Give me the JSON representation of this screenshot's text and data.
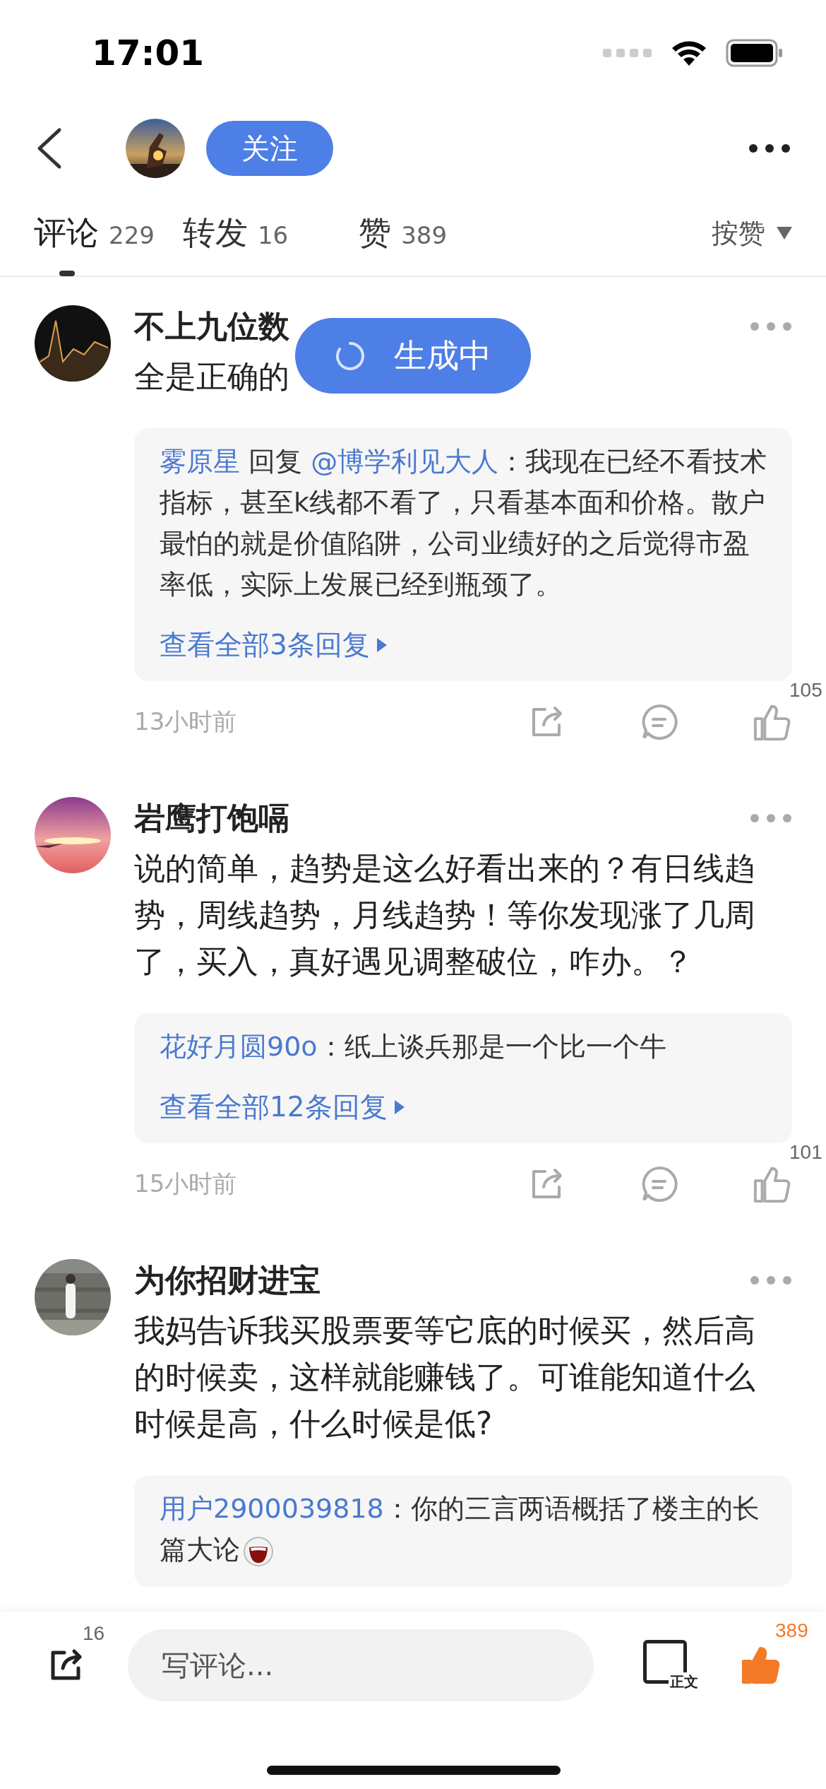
{
  "status_bar": {
    "time": "17:01"
  },
  "header": {
    "follow_button": "关注"
  },
  "tabs": [
    {
      "label": "评论",
      "count": "229",
      "selected": true
    },
    {
      "label": "转发",
      "count": "16",
      "selected": false
    },
    {
      "label": "赞",
      "count": "389",
      "selected": false
    }
  ],
  "sort": {
    "label": "按赞"
  },
  "toast": {
    "text": "生成中"
  },
  "comments": [
    {
      "author": "不上九位数",
      "content": "全是正确的",
      "reply": [
        {
          "kind": "user",
          "text": "雾原星"
        },
        {
          "kind": "plain",
          "text": " 回复 "
        },
        {
          "kind": "user",
          "text": "@博学利见大人"
        },
        {
          "kind": "plain",
          "text": "：我现在已经不看技术指标，甚至k线都不看了，只看基本面和价格。散户最怕的就是价值陷阱，公司业绩好的之后觉得市盈率低，实际上发展已经到瓶颈了。"
        }
      ],
      "view_all": "查看全部3条回复",
      "time": "13小时前",
      "likes": "105"
    },
    {
      "author": "岩鹰打饱嗝",
      "content": "说的简单，趋势是这么好看出来的？有日线趋势，周线趋势，月线趋势！等你发现涨了几周了，买入，真好遇见调整破位，咋办。？",
      "reply": [
        {
          "kind": "user",
          "text": "花好月圆90o"
        },
        {
          "kind": "plain",
          "text": "：纸上谈兵那是一个比一个牛"
        }
      ],
      "view_all": "查看全部12条回复",
      "time": "15小时前",
      "likes": "101"
    },
    {
      "author": "为你招财进宝",
      "content": "我妈告诉我买股票要等它底的时候买，然后高的时候卖，这样就能赚钱了。可谁能知道什么时候是高，什么时候是低?",
      "reply": [
        {
          "kind": "user",
          "text": "用户2900039818"
        },
        {
          "kind": "plain",
          "text": "：你的三言两语概括了楼主的长篇大论"
        },
        {
          "kind": "emoji"
        }
      ]
    }
  ],
  "bottom_bar": {
    "share_count": "16",
    "comment_placeholder": "写评论...",
    "article_button": "正文",
    "like_count": "389"
  }
}
